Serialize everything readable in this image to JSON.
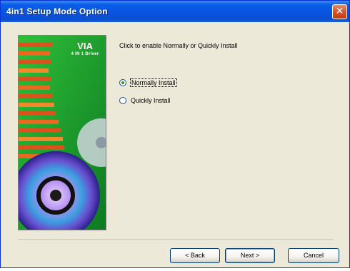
{
  "window": {
    "title": "4in1 Setup Mode Option",
    "close_glyph": "✕"
  },
  "banner": {
    "brand": "VIA",
    "product": "4 IN 1 Driver"
  },
  "content": {
    "instruction": "Click to enable Normally or Quickly Install",
    "options": [
      {
        "label": "Normally Install",
        "selected": true
      },
      {
        "label": "Quickly Install",
        "selected": false
      }
    ]
  },
  "buttons": {
    "back": "< Back",
    "next": "Next >",
    "cancel": "Cancel"
  },
  "colors": {
    "titlebar": "#0a54e0",
    "banner_green": "#14a036",
    "close_red": "#d9532a"
  }
}
